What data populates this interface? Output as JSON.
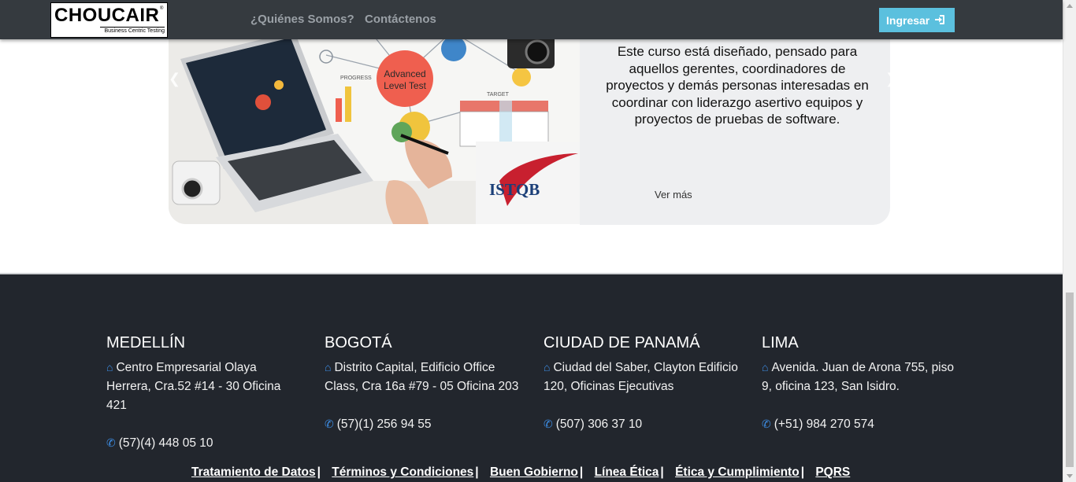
{
  "navbar": {
    "logo_text": "CHOUCAIR",
    "logo_registered": "®",
    "logo_tagline": "Business Centric Testing",
    "links": [
      "¿Quiénes Somos?",
      "Contáctenos"
    ],
    "login_label": "Ingresar",
    "login_icon": "sign-in-icon",
    "login_color": "#5bc0de"
  },
  "course": {
    "image_text_badge": "Advanced Level Test",
    "image_text_brand": "ISTQB",
    "image_text_progress": "PROGRESS",
    "image_text_target": "TARGET",
    "description": "Este curso está diseñado, pensado para aquellos gerentes, coordinadores de proyectos y demás personas interesadas en coordinar con liderazgo asertivo equipos y proyectos de pruebas de software.",
    "more_label": "Ver más"
  },
  "offices": [
    {
      "city": "MEDELLÍN",
      "address": "Centro Empresarial Olaya Herrera, Cra.52 #14 - 30 Oficina 421",
      "phone": "(57)(4) 448 05 10"
    },
    {
      "city": "BOGOTÁ",
      "address": "Distrito Capital, Edificio Office Class, Cra 16a #79 - 05 Oficina 203",
      "phone": "(57)(1) 256 94 55"
    },
    {
      "city": "CIUDAD DE PANAMÁ",
      "address": "Ciudad del Saber, Clayton Edificio 120, Oficinas Ejecutivas",
      "phone": "(507) 306 37 10"
    },
    {
      "city": "LIMA",
      "address": "Avenida. Juan de Arona 755, piso 9, oficina 123, San Isidro.",
      "phone": "(+51) 984 270 574"
    }
  ],
  "footer_links": [
    "Tratamiento de Datos",
    "Términos y Condiciones",
    "Buen Gobierno",
    "Línea Ética",
    "Ética y Cumplimiento",
    "PQRS"
  ],
  "footer_separator": "|",
  "colors": {
    "navbar": "#353a3f",
    "footer": "#22262d",
    "accent_icon": "#3d8ee6",
    "card_text_bg": "#eeeff1"
  }
}
